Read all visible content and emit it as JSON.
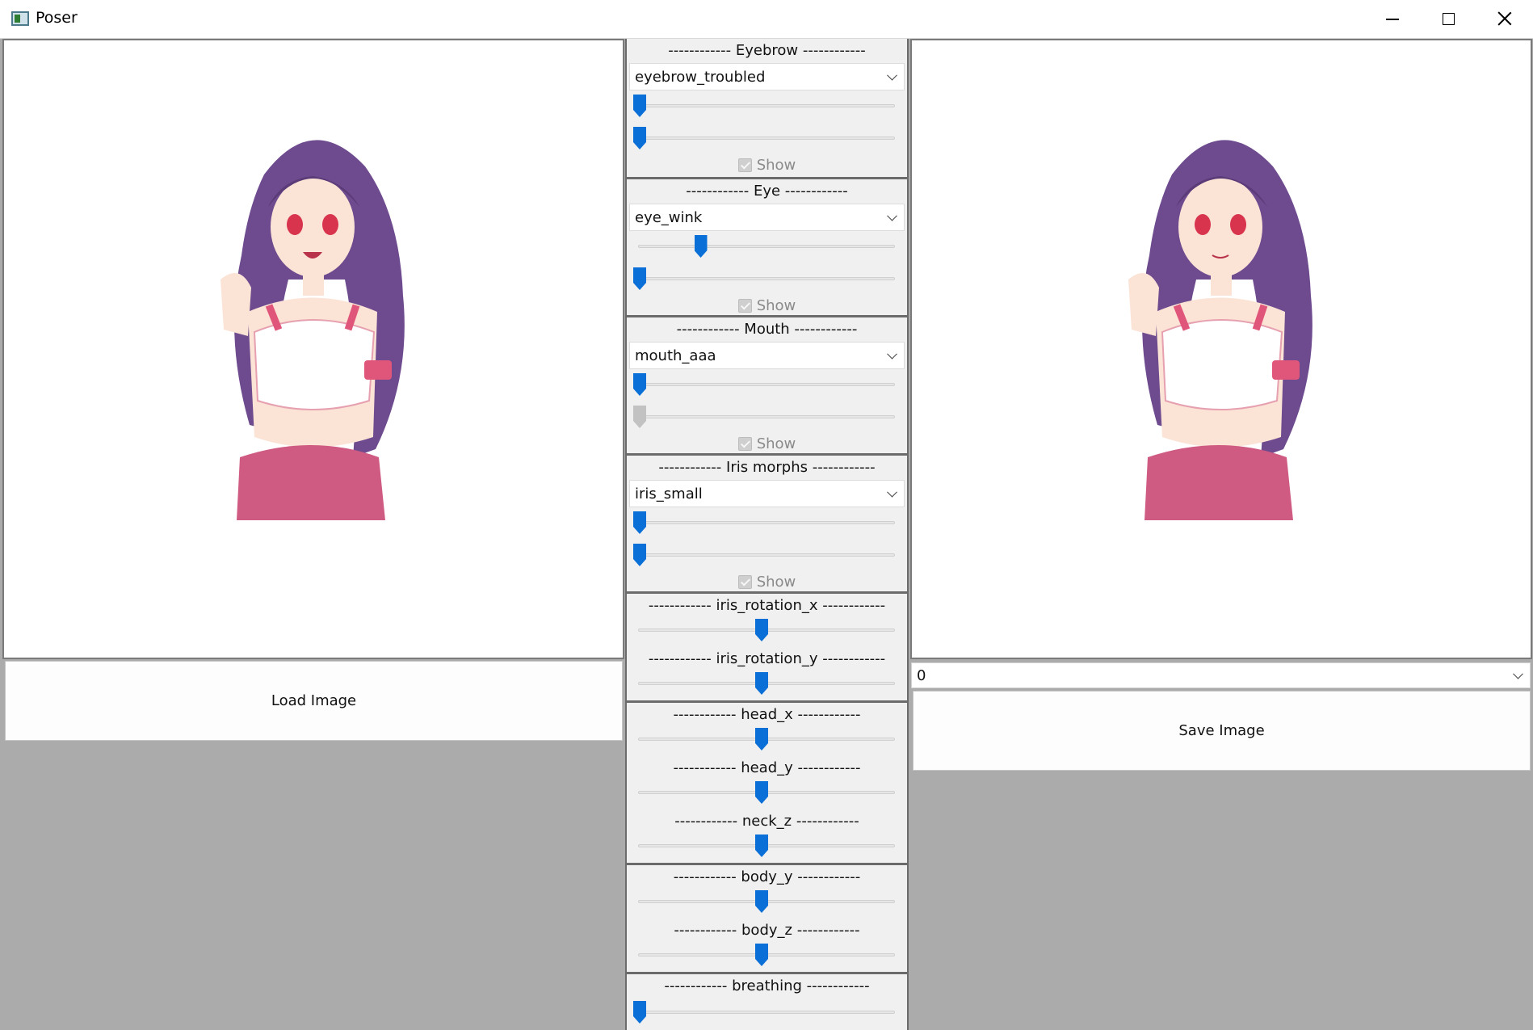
{
  "window": {
    "title": "Poser",
    "controls": [
      "minimize-icon",
      "maximize-icon",
      "close-icon"
    ]
  },
  "left_panel": {
    "load_button": "Load Image"
  },
  "right_panel": {
    "output_index": "0",
    "save_button": "Save Image"
  },
  "groups": {
    "eyebrow": {
      "header": "------------ Eyebrow ------------",
      "selected": "eyebrow_troubled",
      "sliders": [
        0.0,
        0.0
      ],
      "show_label": "Show",
      "show_checked": true,
      "show_enabled": false
    },
    "eye": {
      "header": "------------ Eye ------------",
      "selected": "eye_wink",
      "sliders": [
        0.25,
        0.0
      ],
      "show_label": "Show",
      "show_checked": true,
      "show_enabled": false
    },
    "mouth": {
      "header": "------------ Mouth ------------",
      "selected": "mouth_aaa",
      "sliders": [
        0.0,
        0.0
      ],
      "slider2_enabled": false,
      "show_label": "Show",
      "show_checked": true,
      "show_enabled": false
    },
    "iris_morphs": {
      "header": "------------ Iris morphs ------------",
      "selected": "iris_small",
      "sliders": [
        0.0,
        0.0
      ],
      "show_label": "Show",
      "show_checked": true,
      "show_enabled": false
    },
    "iris_rotation": {
      "x_label": "------------ iris_rotation_x ------------",
      "x_value": 0.5,
      "y_label": "------------ iris_rotation_y ------------",
      "y_value": 0.5
    },
    "head": {
      "head_x_label": "------------ head_x ------------",
      "head_x_value": 0.5,
      "head_y_label": "------------ head_y ------------",
      "head_y_value": 0.5,
      "neck_z_label": "------------ neck_z ------------",
      "neck_z_value": 0.5
    },
    "body": {
      "body_y_label": "------------ body_y ------------",
      "body_y_value": 0.5,
      "body_z_label": "------------ body_z ------------",
      "body_z_value": 0.5
    },
    "breathing": {
      "label": "------------ breathing ------------",
      "value": 0.0
    }
  },
  "colors": {
    "accent": "#0a6fd6",
    "background": "#ababab",
    "panel": "#f0f0f0"
  }
}
